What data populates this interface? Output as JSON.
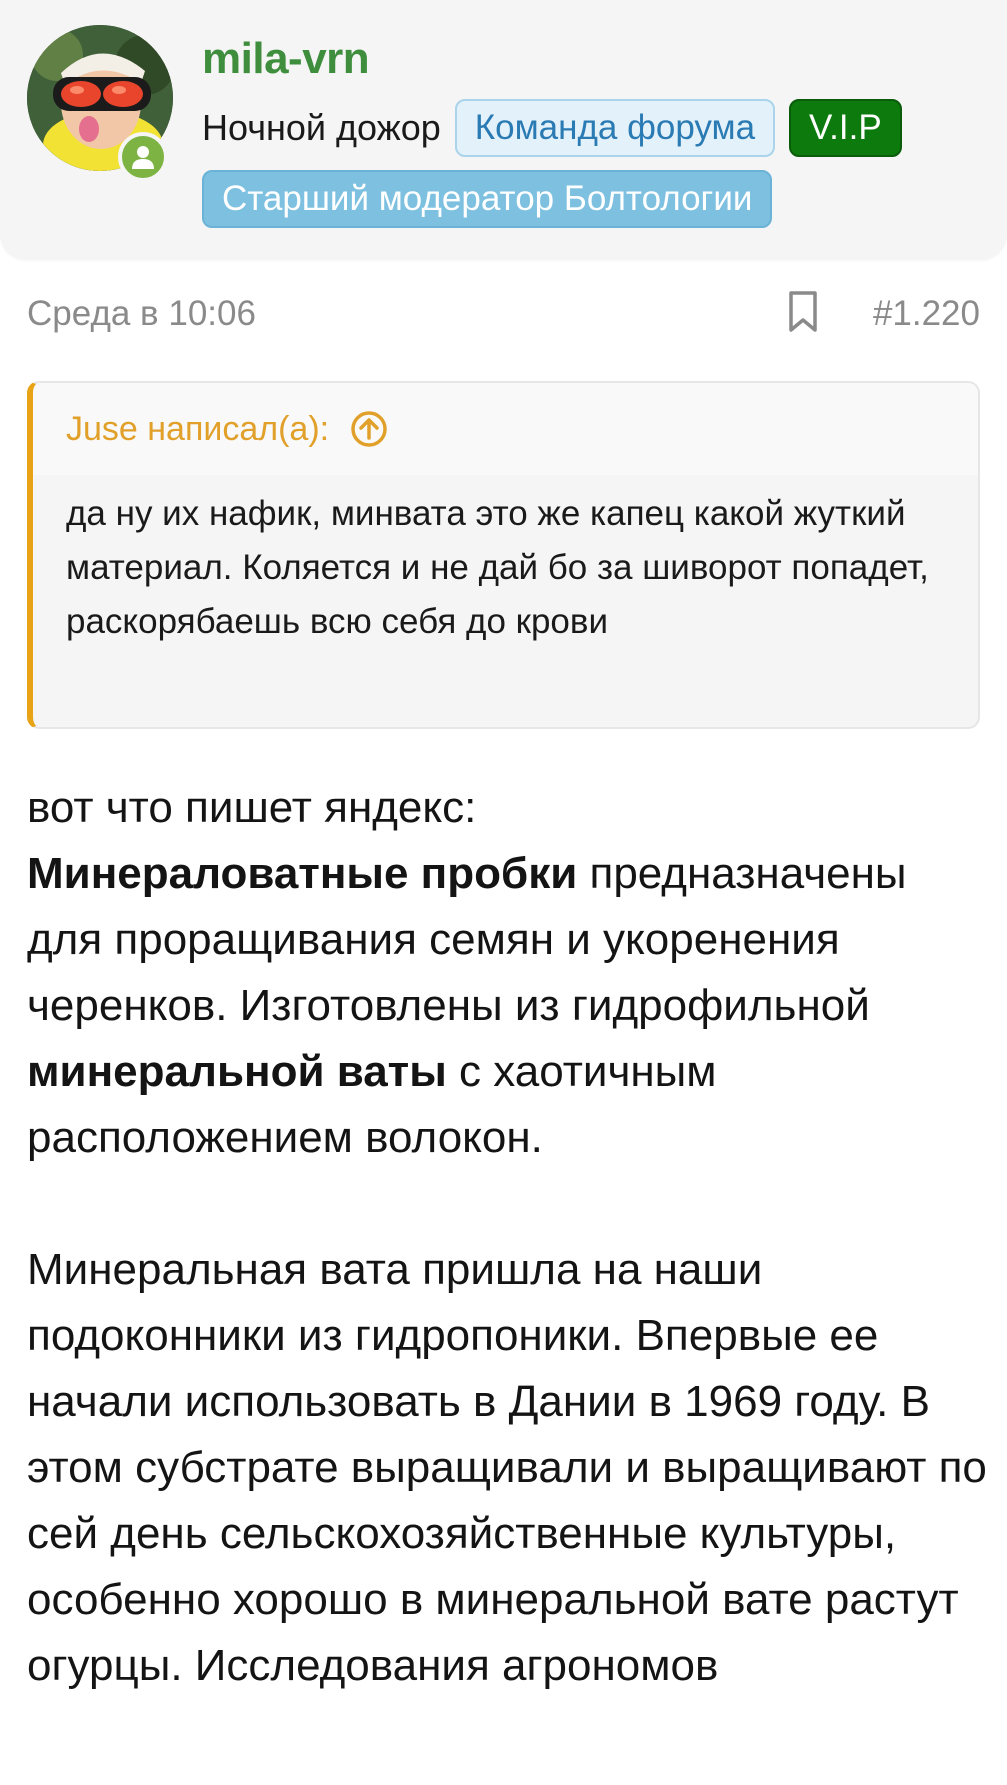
{
  "user": {
    "name": "mila-vrn",
    "title": "Ночной дожор",
    "badges": {
      "team": "Команда форума",
      "vip": "V.I.P",
      "moderator": "Старший модератор Болтологии"
    }
  },
  "post": {
    "date": "Среда в 10:06",
    "number": "#1.220"
  },
  "quote": {
    "author": "Juse написал(а):",
    "text": "да ну их нафик, минвата это же капец какой жуткий материал. Коляется и не дай бо за шиворот попадет, раскорябаешь всю себя до крови"
  },
  "content": {
    "line1": "вот что пишет яндекс:",
    "p2_bold1": "Минераловатные пробки",
    "p2_text1": " предназначены для проращивания семян и укоренения черенков. Изготовлены из гидрофильной ",
    "p2_bold2": "минеральной ваты",
    "p2_text2": " с хаотичным расположением волокон.",
    "p3": "Минеральная вата пришла на наши подоконники из гидропоники. Впервые ее начали использовать в Дании в 1969 году. В этом субстрате выращивали и выращивают по сей день сельскохозяйственные культуры, особенно хорошо в минеральной вате растут огурцы. Исследования агрономов"
  },
  "colors": {
    "username": "#3e8e3e",
    "vip_badge": "#0d7a0d",
    "team_badge_text": "#2a7ab3",
    "moderator_badge": "#7ec0e0",
    "quote_accent": "#e8a317",
    "online_status": "#7cb342"
  },
  "icons": {
    "online": "user-online-icon",
    "bookmark": "bookmark-icon",
    "quote_jump": "arrow-up-circle-icon"
  }
}
